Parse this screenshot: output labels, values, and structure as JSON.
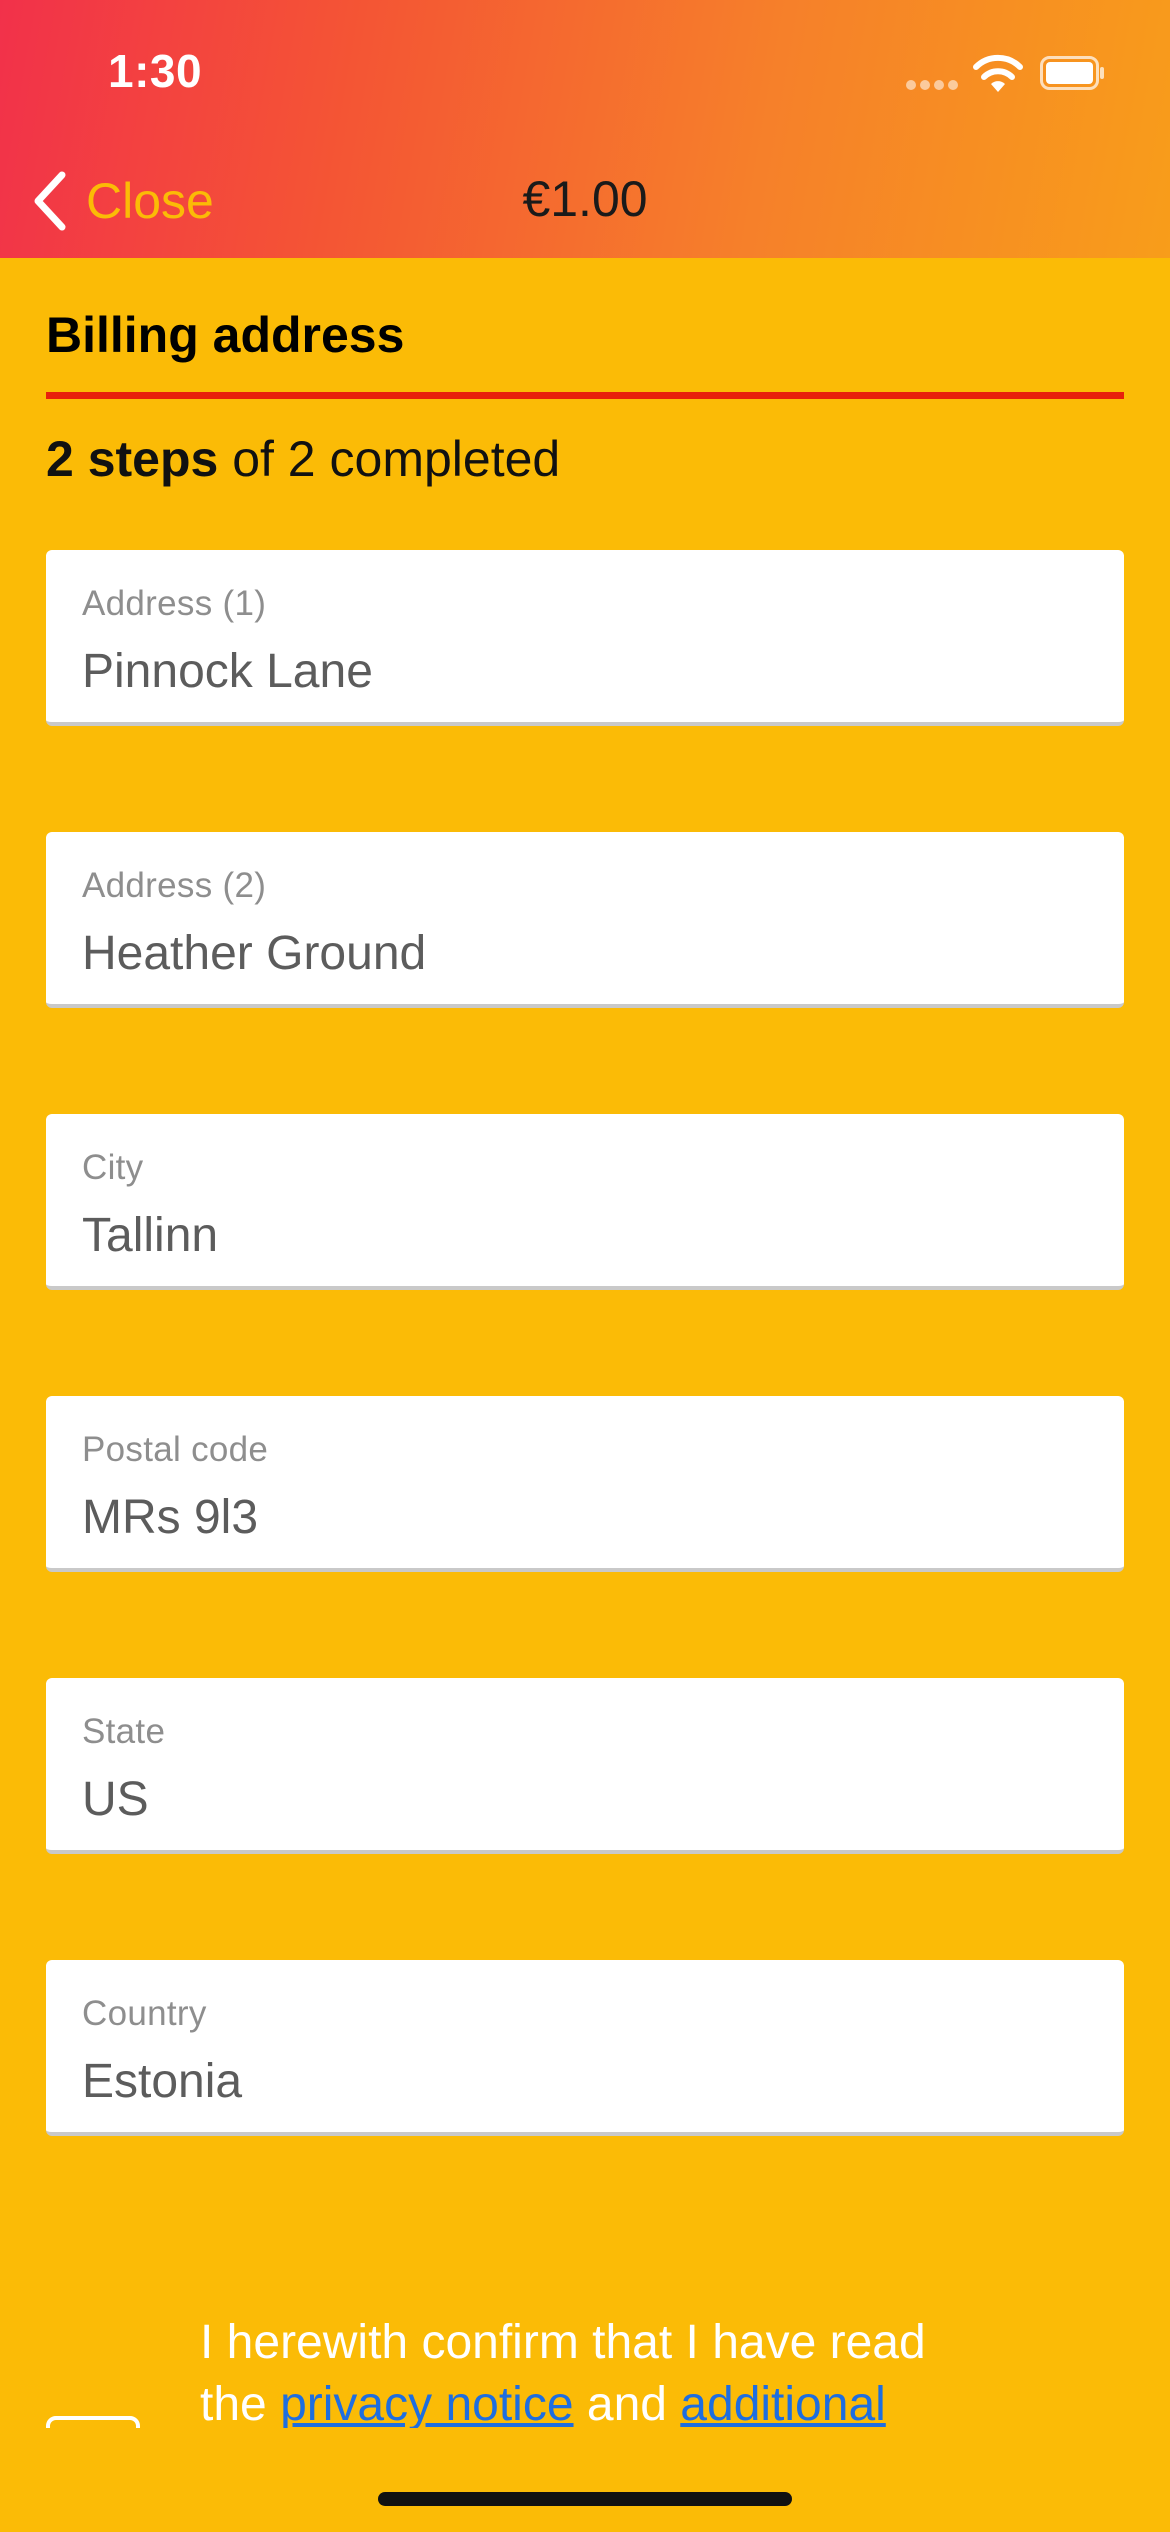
{
  "status_bar": {
    "time": "1:30"
  },
  "nav": {
    "back_label": "Close",
    "title": "€1.00"
  },
  "section": {
    "title": "Billing address",
    "steps_bold": "2 steps",
    "steps_rest": " of 2 completed"
  },
  "fields": [
    {
      "label": "Address (1)",
      "value": "Pinnock Lane"
    },
    {
      "label": "Address (2)",
      "value": "Heather Ground"
    },
    {
      "label": "City",
      "value": "Tallinn"
    },
    {
      "label": "Postal code",
      "value": "MRs 9l3"
    },
    {
      "label": "State",
      "value": "US"
    },
    {
      "label": "Country",
      "value": "Estonia"
    }
  ],
  "consent": {
    "line1": "I herewith confirm that I have read",
    "line2_prefix": "the ",
    "privacy_link": "privacy notice",
    "and": " and ",
    "additional_link": "additional"
  },
  "colors": {
    "background": "#FBBB06",
    "accent_rule": "#E8200B",
    "link": "#1E6EE0",
    "gradient_start": "#F2314A",
    "gradient_end": "#F89D1A"
  },
  "icons": {
    "back": "chevron-left-icon",
    "wifi": "wifi-icon",
    "battery": "battery-icon",
    "signal": "cellular-signal-icon"
  }
}
